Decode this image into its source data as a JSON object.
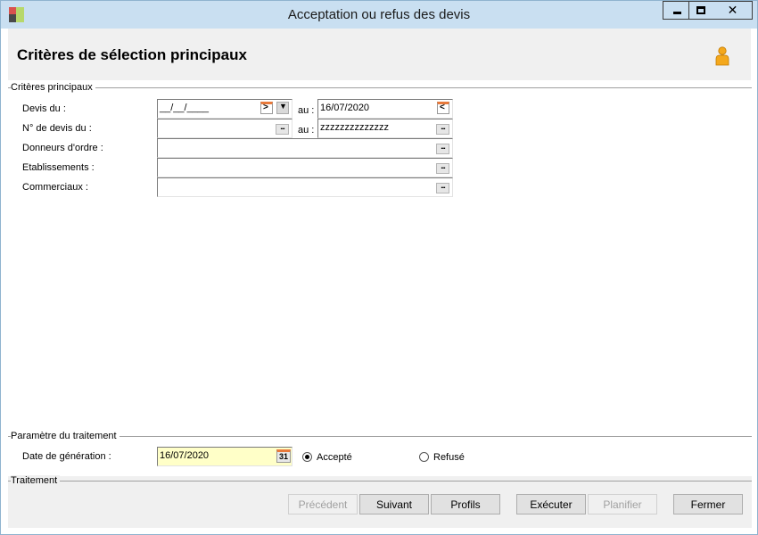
{
  "window": {
    "title": "Acceptation ou refus des devis",
    "controls": {
      "minimize": "minimize-icon",
      "maximize": "maximize-icon",
      "close": "close-icon"
    }
  },
  "header": {
    "title": "Critères de sélection principaux",
    "user_icon": "user-icon"
  },
  "criteres": {
    "section_label": "Critères principaux",
    "devis_du": {
      "label": "Devis du :",
      "value": "__/__/____"
    },
    "devis_au": {
      "label": "au :",
      "value": "16/07/2020"
    },
    "num_du": {
      "label": "N° de devis du :",
      "value": ""
    },
    "num_au": {
      "label": "au :",
      "value": "zzzzzzzzzzzzzz"
    },
    "donneurs": {
      "label": "Donneurs d'ordre :",
      "value": ""
    },
    "etablissements": {
      "label": "Etablissements :",
      "value": ""
    },
    "commerciaux": {
      "label": "Commerciaux :",
      "value": ""
    }
  },
  "parametre": {
    "section_label": "Paramètre du traitement",
    "date_label": "Date de génération :",
    "date_value": "16/07/2020",
    "calendar_day": "31",
    "radio_accepte": {
      "label": "Accepté",
      "checked": true
    },
    "radio_refuse": {
      "label": "Refusé",
      "checked": false
    }
  },
  "traitement": {
    "section_label": "Traitement",
    "buttons": {
      "precedent": {
        "label": "Précédent",
        "enabled": false
      },
      "suivant": {
        "label": "Suivant",
        "enabled": true
      },
      "profils": {
        "label": "Profils",
        "enabled": true
      },
      "executer": {
        "label": "Exécuter",
        "enabled": true
      },
      "planifier": {
        "label": "Planifier",
        "enabled": false
      },
      "fermer": {
        "label": "Fermer",
        "enabled": true
      }
    }
  },
  "colors": {
    "titlebar": "#c9dff1",
    "panel": "#f0f0f0",
    "date_field": "#ffffc8",
    "accent_orange": "#f4a81c"
  }
}
